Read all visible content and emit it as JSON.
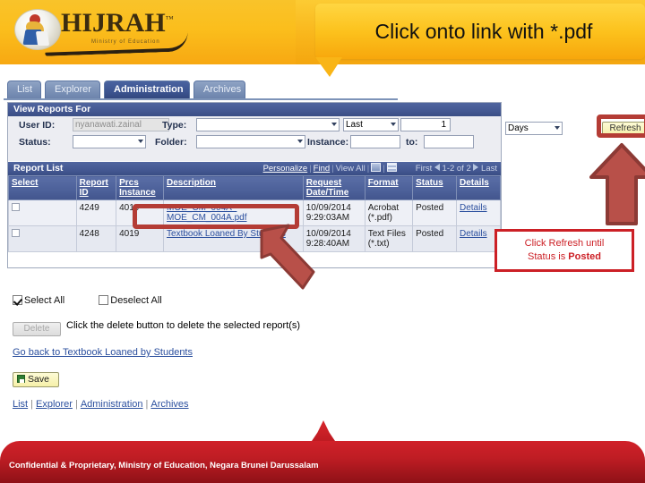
{
  "brand": {
    "name": "HIJRAH",
    "trademark": "™",
    "tagline": "Ministry of Education"
  },
  "callout_pdf": {
    "text": "Click onto link with *.pdf"
  },
  "tabs": [
    {
      "label": "List",
      "active": false
    },
    {
      "label": "Explorer",
      "active": false
    },
    {
      "label": "Administration",
      "active": true
    },
    {
      "label": "Archives",
      "active": false
    }
  ],
  "view_reports_for": {
    "title": "View Reports For",
    "user_id_label": "User ID:",
    "user_id_value": "nyanawati.zainal",
    "status_label": "Status:",
    "status_value": "",
    "type_label": "Type:",
    "type_value": "",
    "folder_label": "Folder:",
    "folder_value": "",
    "last_value": "Last",
    "count_value": "1",
    "unit_value": "Days",
    "instance_label": "Instance:",
    "instance_value": "",
    "to_label": "to:",
    "to_value": "",
    "refresh_label": "Refresh"
  },
  "report_list": {
    "title": "Report List",
    "tools": {
      "personalize": "Personalize",
      "find": "Find",
      "view_all": "View All",
      "download_icon": "download-spreadsheet-icon",
      "grid_icon": "grid-view-icon"
    },
    "pager": {
      "first": "First",
      "range": "1-2 of 2",
      "last": "Last"
    },
    "columns": [
      "Select",
      "Report ID",
      "Prcs Instance",
      "Description",
      "Request Date/Time",
      "Format",
      "Status",
      "Details"
    ],
    "rows": [
      {
        "select": false,
        "report_id": "4249",
        "prcs_instance": "4019",
        "description": "MOE_CM_004A - MOE_CM_004A.pdf",
        "request_datetime": "10/09/2014 9:29:03AM",
        "format": "Acrobat (*.pdf)",
        "status": "Posted",
        "details": "Details"
      },
      {
        "select": false,
        "report_id": "4248",
        "prcs_instance": "4019",
        "description": "Textbook Loaned By Students",
        "request_datetime": "10/09/2014 9:28:40AM",
        "format": "Text Files (*.txt)",
        "status": "Posted",
        "details": "Details"
      }
    ]
  },
  "note_box": {
    "line1": "Click Refresh until",
    "line2_prefix": "Status is ",
    "line2_bold": "Posted"
  },
  "bottom": {
    "select_all": "Select All",
    "deselect_all": "Deselect All",
    "delete_button": "Delete",
    "delete_hint": "Click the delete button to delete the selected report(s)",
    "go_back_link": "Go back to Textbook Loaned by Students",
    "save_button": "Save",
    "footer_links": [
      "List",
      "Explorer",
      "Administration",
      "Archives"
    ]
  },
  "footer": {
    "text": "Confidential & Proprietary, Ministry of Education, Negara Brunei Darussalam"
  },
  "colors": {
    "brand_gold": "#f9b516",
    "panel_blue": "#445892",
    "accent_red": "#cc2026",
    "arrow_red": "#b85049",
    "footer_red": "#bf1d24"
  }
}
